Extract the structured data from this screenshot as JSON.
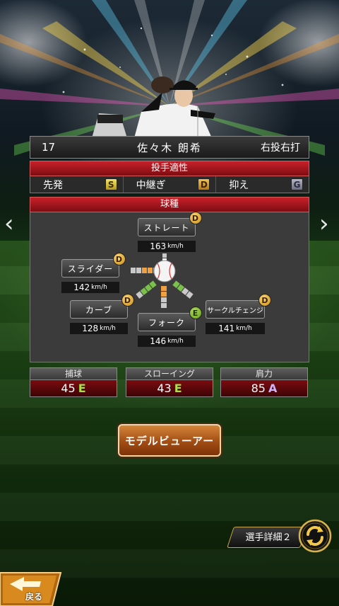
{
  "player": {
    "number": "17",
    "name": "佐々木 朗希",
    "handedness": "右投右打"
  },
  "aptitude": {
    "title": "投手適性",
    "items": [
      {
        "label": "先発",
        "grade": "S"
      },
      {
        "label": "中継ぎ",
        "grade": "D"
      },
      {
        "label": "抑え",
        "grade": "G"
      }
    ]
  },
  "pitches": {
    "title": "球種",
    "unit": "km/h",
    "items": [
      {
        "name": "ストレート",
        "rank": "D",
        "speed": "163"
      },
      {
        "name": "スライダー",
        "rank": "D",
        "speed": "142"
      },
      {
        "name": "カーブ",
        "rank": "D",
        "speed": "128"
      },
      {
        "name": "フォーク",
        "rank": "E",
        "speed": "146"
      },
      {
        "name": "サークルチェンジ",
        "rank": "D",
        "speed": "141"
      }
    ]
  },
  "stats": [
    {
      "label": "捕球",
      "value": "45",
      "grade": "E"
    },
    {
      "label": "スローイング",
      "value": "43",
      "grade": "E"
    },
    {
      "label": "肩力",
      "value": "85",
      "grade": "A"
    }
  ],
  "buttons": {
    "model_viewer": "モデルビューアー",
    "player_detail": "選手詳細２",
    "back": "戻る"
  },
  "nav": {
    "prev": "‹",
    "next": "›"
  },
  "colors": {
    "header_red": "#c8202a",
    "panel_gray": "#3b3b3b",
    "button_orange": "#a24d14",
    "grade_e": "#a6e04a",
    "grade_a": "#c9b5ff"
  }
}
